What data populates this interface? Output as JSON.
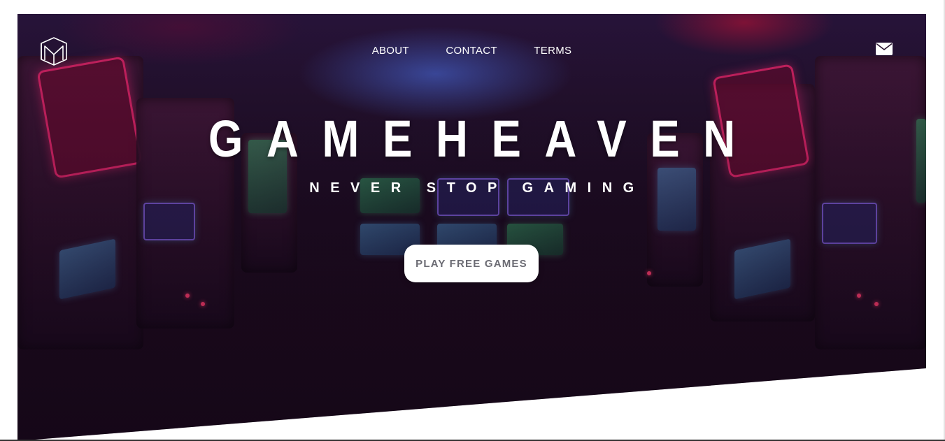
{
  "nav": {
    "logo_icon": "m-monogram-logo-icon",
    "items": [
      {
        "label": "ABOUT"
      },
      {
        "label": "CONTACT"
      },
      {
        "label": "TERMS"
      }
    ],
    "mail_icon": "envelope-icon"
  },
  "hero": {
    "title": "GAMEHEAVEN",
    "subtitle": "NEVER STOP GAMING",
    "cta_label": "PLAY FREE GAMES",
    "background_image": "dark arcade room with slot machines",
    "accent_colors": {
      "neon_pink": "#e0256a",
      "neon_blue": "#465fc8",
      "base_dark": "#1a0a1c"
    }
  }
}
